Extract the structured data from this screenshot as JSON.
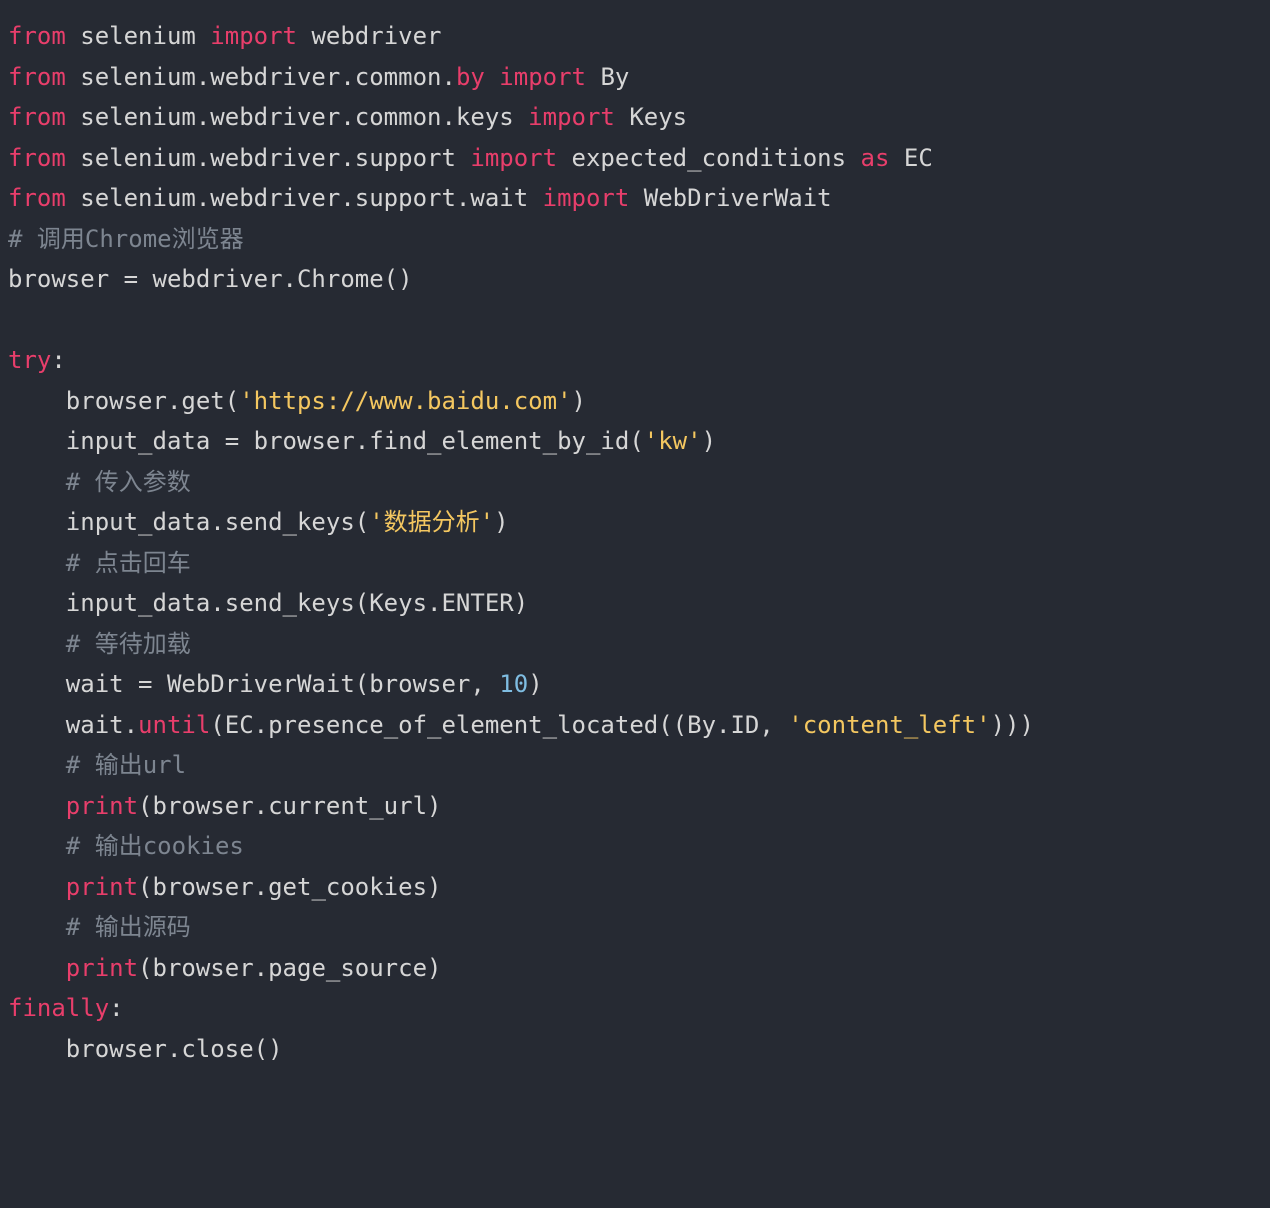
{
  "tokens": {
    "from": "from",
    "import": "import",
    "as": "as",
    "print": "print",
    "try": "try",
    "finally": "finally",
    "until": "until",
    "by": "by"
  },
  "code": {
    "l1_mod1": " selenium ",
    "l1_mod2": " webdriver",
    "l2_mod1": " selenium.webdriver.common.",
    "l2_mod2": " By",
    "l3_mod1": " selenium.webdriver.common.keys ",
    "l3_mod2": " Keys",
    "l4_mod1": " selenium.webdriver.support ",
    "l4_mod2": " expected_conditions ",
    "l4_mod3": " EC",
    "l5_mod1": " selenium.webdriver.support.wait ",
    "l5_mod2": " WebDriverWait",
    "c1": "# 调用Chrome浏览器",
    "l7": "browser = webdriver.Chrome()",
    "l9": ":",
    "l10a": "    browser.get(",
    "s_url": "'https://www.baidu.com'",
    "l10b": ")",
    "l11a": "    input_data = browser.find_element_by_id(",
    "s_kw": "'kw'",
    "l11b": ")",
    "c2": "    # 传入参数",
    "l13a": "    input_data.send_keys(",
    "s_data": "'数据分析'",
    "l13b": ")",
    "c3": "    # 点击回车",
    "l15": "    input_data.send_keys(Keys.ENTER)",
    "c4": "    # 等待加载",
    "l17a": "    wait = WebDriverWait(browser, ",
    "n10": "10",
    "l17b": ")",
    "l18a": "    wait.",
    "l18b": "(EC.presence_of_element_located((By.ID, ",
    "s_cl": "'content_left'",
    "l18c": ")))",
    "c5": "    # 输出url",
    "l20a": "    ",
    "l20b": "(browser.current_url)",
    "c6": "    # 输出cookies",
    "l22b": "(browser.get_cookies)",
    "c7": "    # 输出源码",
    "l24b": "(browser.page_source)",
    "l25": ":",
    "l26": "    browser.close()"
  }
}
